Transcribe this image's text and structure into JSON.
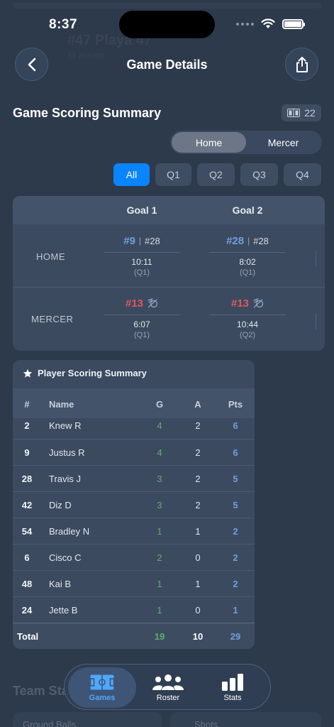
{
  "status_bar": {
    "time": "8:37"
  },
  "background_ghost": {
    "title": "#47 Playa 47",
    "subtitle": "11 assists"
  },
  "header": {
    "title": "Game Details"
  },
  "summary": {
    "title": "Game Scoring Summary",
    "goals_badge_count": "22"
  },
  "team_toggle": {
    "options": [
      "Home",
      "Mercer"
    ],
    "selected": "Home"
  },
  "quarter_filter": {
    "options": [
      "All",
      "Q1",
      "Q2",
      "Q3",
      "Q4"
    ],
    "selected": "All"
  },
  "goals_table": {
    "columns": [
      "Goal 1",
      "Goal 2"
    ],
    "rows": [
      {
        "team": "HOME",
        "goals": [
          {
            "scorer": "#9",
            "assist": "#28",
            "time": "10:11",
            "quarter": "(Q1)"
          },
          {
            "scorer": "#28",
            "assist": "#28",
            "time": "8:02",
            "quarter": "(Q1)"
          }
        ]
      },
      {
        "team": "MERCER",
        "goals": [
          {
            "scorer": "#13",
            "time": "6:07",
            "quarter": "(Q1)"
          },
          {
            "scorer": "#13",
            "time": "10:44",
            "quarter": "(Q2)"
          }
        ]
      }
    ]
  },
  "player_summary": {
    "title": "Player Scoring Summary",
    "headers": {
      "num": "#",
      "name": "Name",
      "g": "G",
      "a": "A",
      "pts": "Pts"
    },
    "rows": [
      {
        "num": "2",
        "name": "Knew R",
        "g": "4",
        "a": "2",
        "pts": "6"
      },
      {
        "num": "9",
        "name": "Justus R",
        "g": "4",
        "a": "2",
        "pts": "6"
      },
      {
        "num": "28",
        "name": "Travis J",
        "g": "3",
        "a": "2",
        "pts": "5"
      },
      {
        "num": "42",
        "name": "Diz D",
        "g": "3",
        "a": "2",
        "pts": "5"
      },
      {
        "num": "54",
        "name": "Bradley N",
        "g": "1",
        "a": "1",
        "pts": "2"
      },
      {
        "num": "6",
        "name": "Cisco C",
        "g": "2",
        "a": "0",
        "pts": "2"
      },
      {
        "num": "48",
        "name": "Kai B",
        "g": "1",
        "a": "1",
        "pts": "2"
      },
      {
        "num": "24",
        "name": "Jette B",
        "g": "1",
        "a": "0",
        "pts": "1"
      }
    ],
    "total": {
      "label": "Total",
      "g": "19",
      "a": "10",
      "pts": "29"
    }
  },
  "team_stats": {
    "title": "Team Stats",
    "cards": [
      "Ground Balls",
      "Shots"
    ]
  },
  "tab_bar": {
    "tabs": [
      {
        "label": "Games",
        "icon": "field-icon"
      },
      {
        "label": "Roster",
        "icon": "people-icon"
      },
      {
        "label": "Stats",
        "icon": "bar-chart-icon"
      }
    ],
    "selected": "Games"
  },
  "colors": {
    "background": "#2d3a4c",
    "accent_blue": "#0a84ff",
    "home_blue": "#6f9fdc",
    "mercer_red": "#e0575f",
    "goals_green": "#5fae6b"
  }
}
